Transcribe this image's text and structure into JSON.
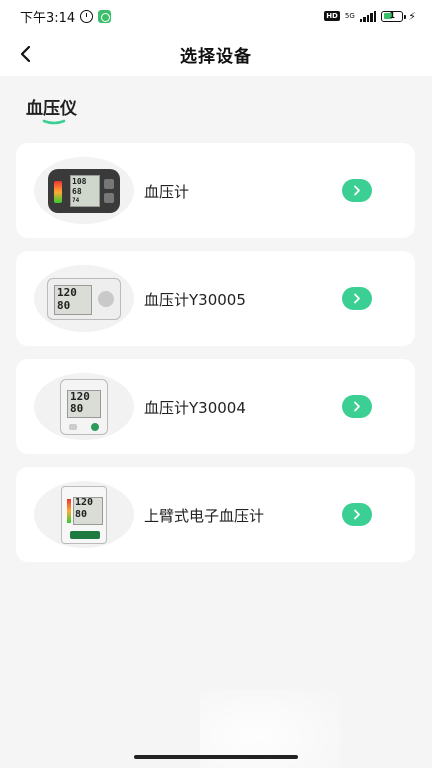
{
  "status_bar": {
    "time": "下午3:14",
    "hd": "HD",
    "network": "5G",
    "battery": "1",
    "icons": [
      "alarm-icon",
      "app-notification-icon",
      "signal-icon",
      "battery-icon",
      "charging-icon"
    ]
  },
  "header": {
    "title": "选择设备",
    "back_icon": "chevron-left-icon"
  },
  "section": {
    "title": "血压仪"
  },
  "devices": [
    {
      "name": "血压计",
      "thumb": "wrist-monitor"
    },
    {
      "name": "血压计Y30005",
      "thumb": "arm-monitor-wide"
    },
    {
      "name": "血压计Y30004",
      "thumb": "arm-monitor-square"
    },
    {
      "name": "上臂式电子血压计",
      "thumb": "arm-monitor-tall"
    }
  ],
  "colors": {
    "accent": "#3ccf94",
    "background": "#f5f5f5",
    "card": "#ffffff"
  }
}
